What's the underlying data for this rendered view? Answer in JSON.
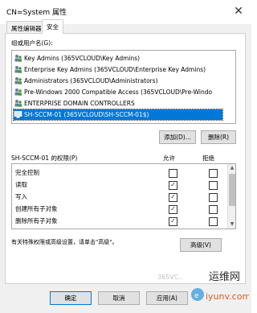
{
  "window": {
    "title": "CN=System 属性",
    "close_glyph": "✕"
  },
  "tabs": [
    {
      "label": "属性编辑器",
      "active": false
    },
    {
      "label": "安全",
      "active": true
    }
  ],
  "principals": {
    "label": "组或用户名(G):",
    "items": [
      {
        "label": "Key Admins (365VCLOUD\\Key Admins)",
        "selected": false
      },
      {
        "label": "Enterprise Key Admins (365VCLOUD\\Enterprise Key Admins)",
        "selected": false
      },
      {
        "label": "Administrators (365VCLOUD\\Administrators)",
        "selected": false
      },
      {
        "label": "Pre-Windows 2000 Compatible Access (365VCLOUD\\Pre-Windo",
        "selected": false
      },
      {
        "label": "ENTERPRISE DOMAIN CONTROLLERS",
        "selected": false
      },
      {
        "label": "SH-SCCM-01 (365VCLOUD\\SH-SCCM-01$)",
        "selected": true
      }
    ]
  },
  "buttons": {
    "add": "添加(D)...",
    "remove": "删除(R)",
    "advanced": "高级(V)",
    "ok": "确定",
    "cancel": "取消",
    "apply": "应用(A)"
  },
  "permissions": {
    "label": "SH-SCCM-01 的权限(P)",
    "allow_header": "允许",
    "deny_header": "拒绝",
    "rows": [
      {
        "name": "完全控制",
        "allow": false,
        "deny": false
      },
      {
        "name": "读取",
        "allow": true,
        "deny": false
      },
      {
        "name": "写入",
        "allow": true,
        "deny": false
      },
      {
        "name": "创建所有子对象",
        "allow": true,
        "deny": false
      },
      {
        "name": "删除所有子对象",
        "allow": true,
        "deny": false
      }
    ]
  },
  "advanced_hint": "有关特殊权限或高级设置，请单击\"高级\"。",
  "watermark": "365VC.."
}
